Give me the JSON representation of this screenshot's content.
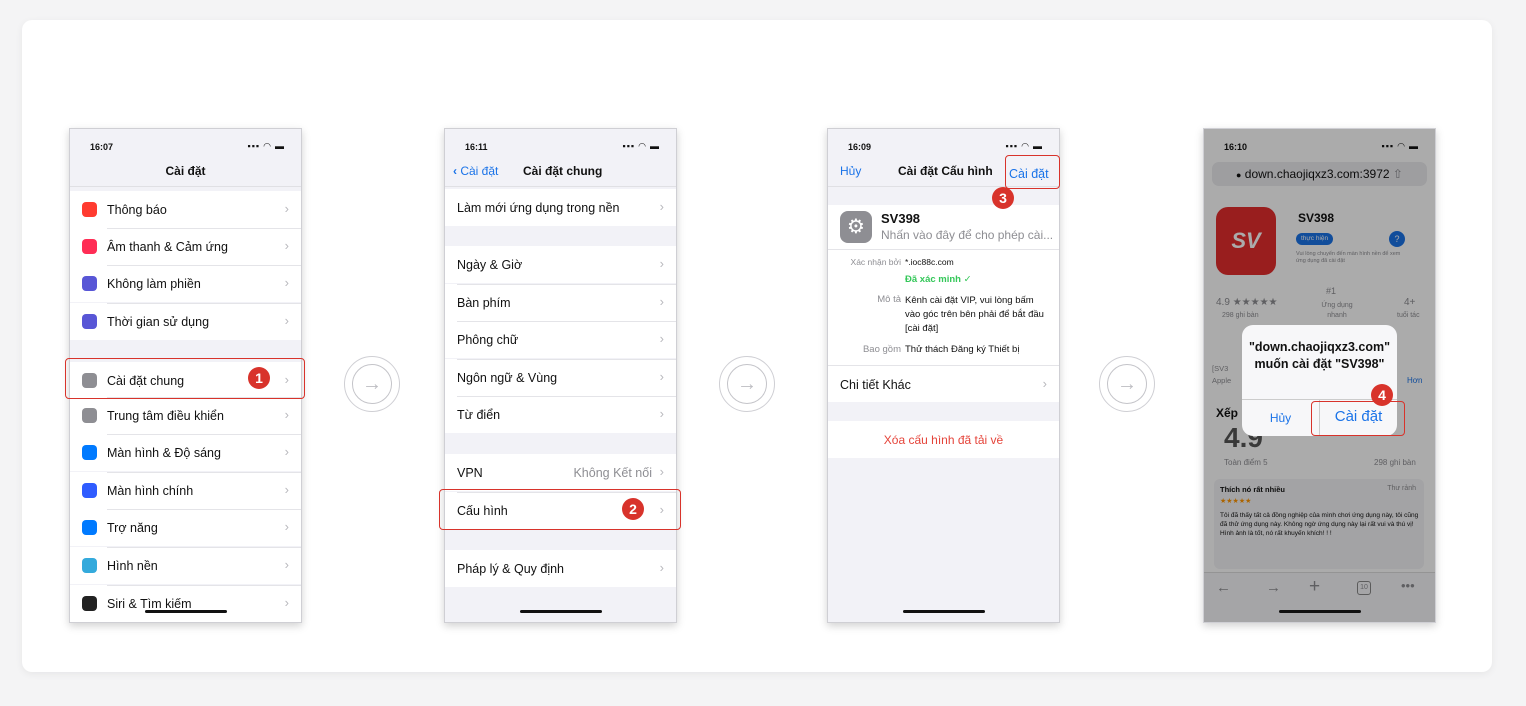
{
  "phone1": {
    "time": "16:07",
    "title": "Cài đặt",
    "items": [
      {
        "label": "Thông báo",
        "icon": "notification-icon",
        "color": "#ff3b30"
      },
      {
        "label": "Âm thanh & Cảm ứng",
        "icon": "sound-icon",
        "color": "#ff2d55"
      },
      {
        "label": "Không làm phiền",
        "icon": "moon-icon",
        "color": "#5856d6"
      },
      {
        "label": "Thời gian sử dụng",
        "icon": "hourglass-icon",
        "color": "#5856d6"
      },
      {
        "label": "Cài đặt chung",
        "icon": "gear-icon",
        "color": "#8e8e93"
      },
      {
        "label": "Trung tâm điều khiển",
        "icon": "control-center-icon",
        "color": "#8e8e93"
      },
      {
        "label": "Màn hình & Độ sáng",
        "icon": "display-icon",
        "color": "#007aff"
      },
      {
        "label": "Màn hình chính",
        "icon": "home-screen-icon",
        "color": "#2f5cff"
      },
      {
        "label": "Trợ năng",
        "icon": "accessibility-icon",
        "color": "#007aff"
      },
      {
        "label": "Hình nền",
        "icon": "wallpaper-icon",
        "color": "#34aadc"
      },
      {
        "label": "Siri & Tìm kiếm",
        "icon": "siri-icon",
        "color": "#222"
      }
    ],
    "step": "1"
  },
  "phone2": {
    "time": "16:11",
    "back_label": "Cài đặt",
    "title": "Cài đặt chung",
    "items": [
      {
        "label": "Làm mới ứng dụng trong nền"
      },
      {
        "label": "Ngày & Giờ"
      },
      {
        "label": "Bàn phím"
      },
      {
        "label": "Phông chữ"
      },
      {
        "label": "Ngôn ngữ & Vùng"
      },
      {
        "label": "Từ điển"
      },
      {
        "label": "VPN",
        "value": "Không Kết nối"
      },
      {
        "label": "Cấu hình"
      },
      {
        "label": "Pháp lý & Quy định"
      }
    ],
    "step": "2"
  },
  "phone3": {
    "time": "16:09",
    "cancel_label": "Hủy",
    "title": "Cài đặt Cấu hình",
    "install_label": "Cài đặt",
    "profile_name": "SV398",
    "profile_sub": "Nhấn vào đây để cho phép cài...",
    "signed_by_label": "Xác nhận bởi",
    "signed_by_value": "*.ioc88c.com",
    "verified": "Đã xác minh ✓",
    "desc_label": "Mô tả",
    "desc_value": "Kênh cài đặt VIP, vui lòng bấm vào góc trên bên phải để bắt đầu [cài đặt]",
    "contains_label": "Bao gồm",
    "contains_value": "Thử thách Đăng ký Thiết bị",
    "more_details": "Chi tiết Khác",
    "remove_label": "Xóa cấu hình đã tải về",
    "step": "3"
  },
  "phone4": {
    "time": "16:10",
    "url": "down.chaojiqxz3.com:3972",
    "app_name": "SV398",
    "app_tag": "thực hiện",
    "app_desc": "Vui lòng chuyển đến màn hình nền để xem ứng dụng đã cài đặt",
    "rating": "4.9",
    "stars": "★★★★★",
    "rating_count": "298 ghi bàn",
    "rank": "#1",
    "rank_label": "Ứng dụng nhanh",
    "age": "4+",
    "age_label": "tuổi tác",
    "section_partial": "Xếp",
    "big_rating": "4.9",
    "score_label": "Toàn điểm 5",
    "score_count": "298 ghi bàn",
    "review_title": "Thích nó rất nhiều",
    "review_meta": "Thư rảnh",
    "review_body": "Tôi đã thấy tất cả đồng nghiệp của mình chơi ứng dụng này, tôi cũng đã thử ứng dụng này. Không ngờ ứng dụng này lại rất vui và thú vị! Hình ảnh là tốt, nó rất khuyến khích! ! !",
    "partial_left": "[SV3",
    "partial_left2": "Apple",
    "partial_right": "Hơn",
    "tab_count": "10",
    "dialog_text": "\"down.chaojiqxz3.com\" muốn cài đặt \"SV398\"",
    "dialog_cancel": "Hủy",
    "dialog_install": "Cài đặt",
    "step": "4"
  },
  "colors": {
    "accent": "#1a73e8",
    "highlight": "#d8332b",
    "brand": "#e42d2d"
  }
}
